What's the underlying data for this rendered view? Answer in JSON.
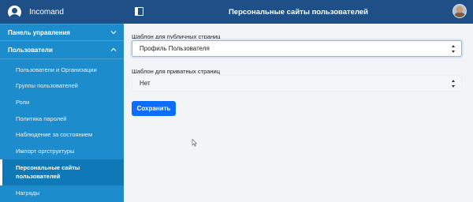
{
  "brand": {
    "name": "Incomand"
  },
  "topbar": {
    "title": "Персональные сайты пользователей"
  },
  "sidebar": {
    "sections": [
      {
        "label": "Панель управления"
      },
      {
        "label": "Пользователи"
      }
    ],
    "items": [
      {
        "label": "Пользователи и Организации"
      },
      {
        "label": "Группы пользователей"
      },
      {
        "label": "Роли"
      },
      {
        "label": "Политика паролей"
      },
      {
        "label": "Наблюдение за состоянием"
      },
      {
        "label": "Импорт оргструктуры"
      },
      {
        "label_line1": "Персональные сайты",
        "label_line2": "пользователей",
        "active": true
      },
      {
        "label": "Награды"
      }
    ]
  },
  "form": {
    "public_label": "Шаблон для публичных страниц",
    "public_value": "Профиль Пользователя",
    "private_label": "Шаблон для приватных страниц",
    "private_value": "Нет",
    "save_label": "Сохранить"
  },
  "colors": {
    "sidebar_bg": "#1c8ccc",
    "topbar_bg": "#1e4f86",
    "primary_button": "#0d6efd"
  }
}
